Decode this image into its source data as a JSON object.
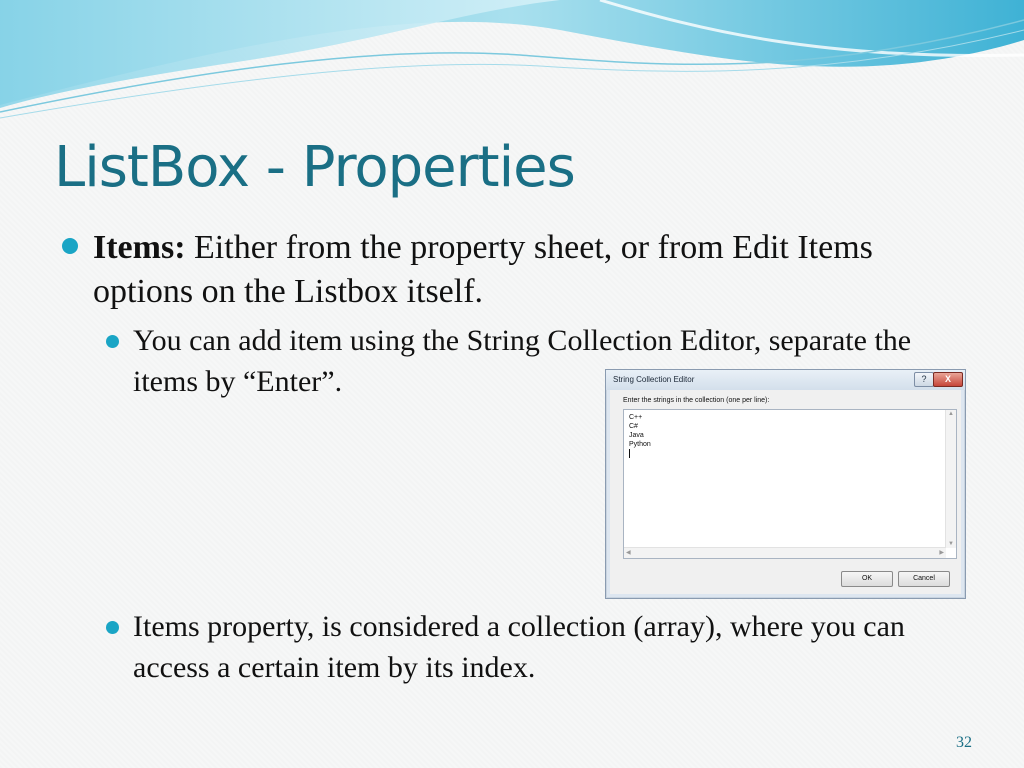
{
  "slide": {
    "title": "ListBox - Properties",
    "bullet1": {
      "bold_label": "Items:",
      "text": " Either from the property sheet, or from Edit Items options on the Listbox itself."
    },
    "bullet2": "You can add item using the String Collection Editor, separate the items by “Enter”.",
    "bullet3": "Items property, is considered a collection (array), where you can access a certain item by its index.",
    "page_number": "32",
    "colors": {
      "title": "#1a6f85",
      "bullet": "#1aa5c5"
    }
  },
  "dialog": {
    "title": "String Collection Editor",
    "help_label": "?",
    "close_label": "X",
    "instruction": "Enter the strings in the collection (one per line):",
    "lines": [
      "C++",
      "C#",
      "Java",
      "Python"
    ],
    "ok_label": "OK",
    "cancel_label": "Cancel"
  }
}
